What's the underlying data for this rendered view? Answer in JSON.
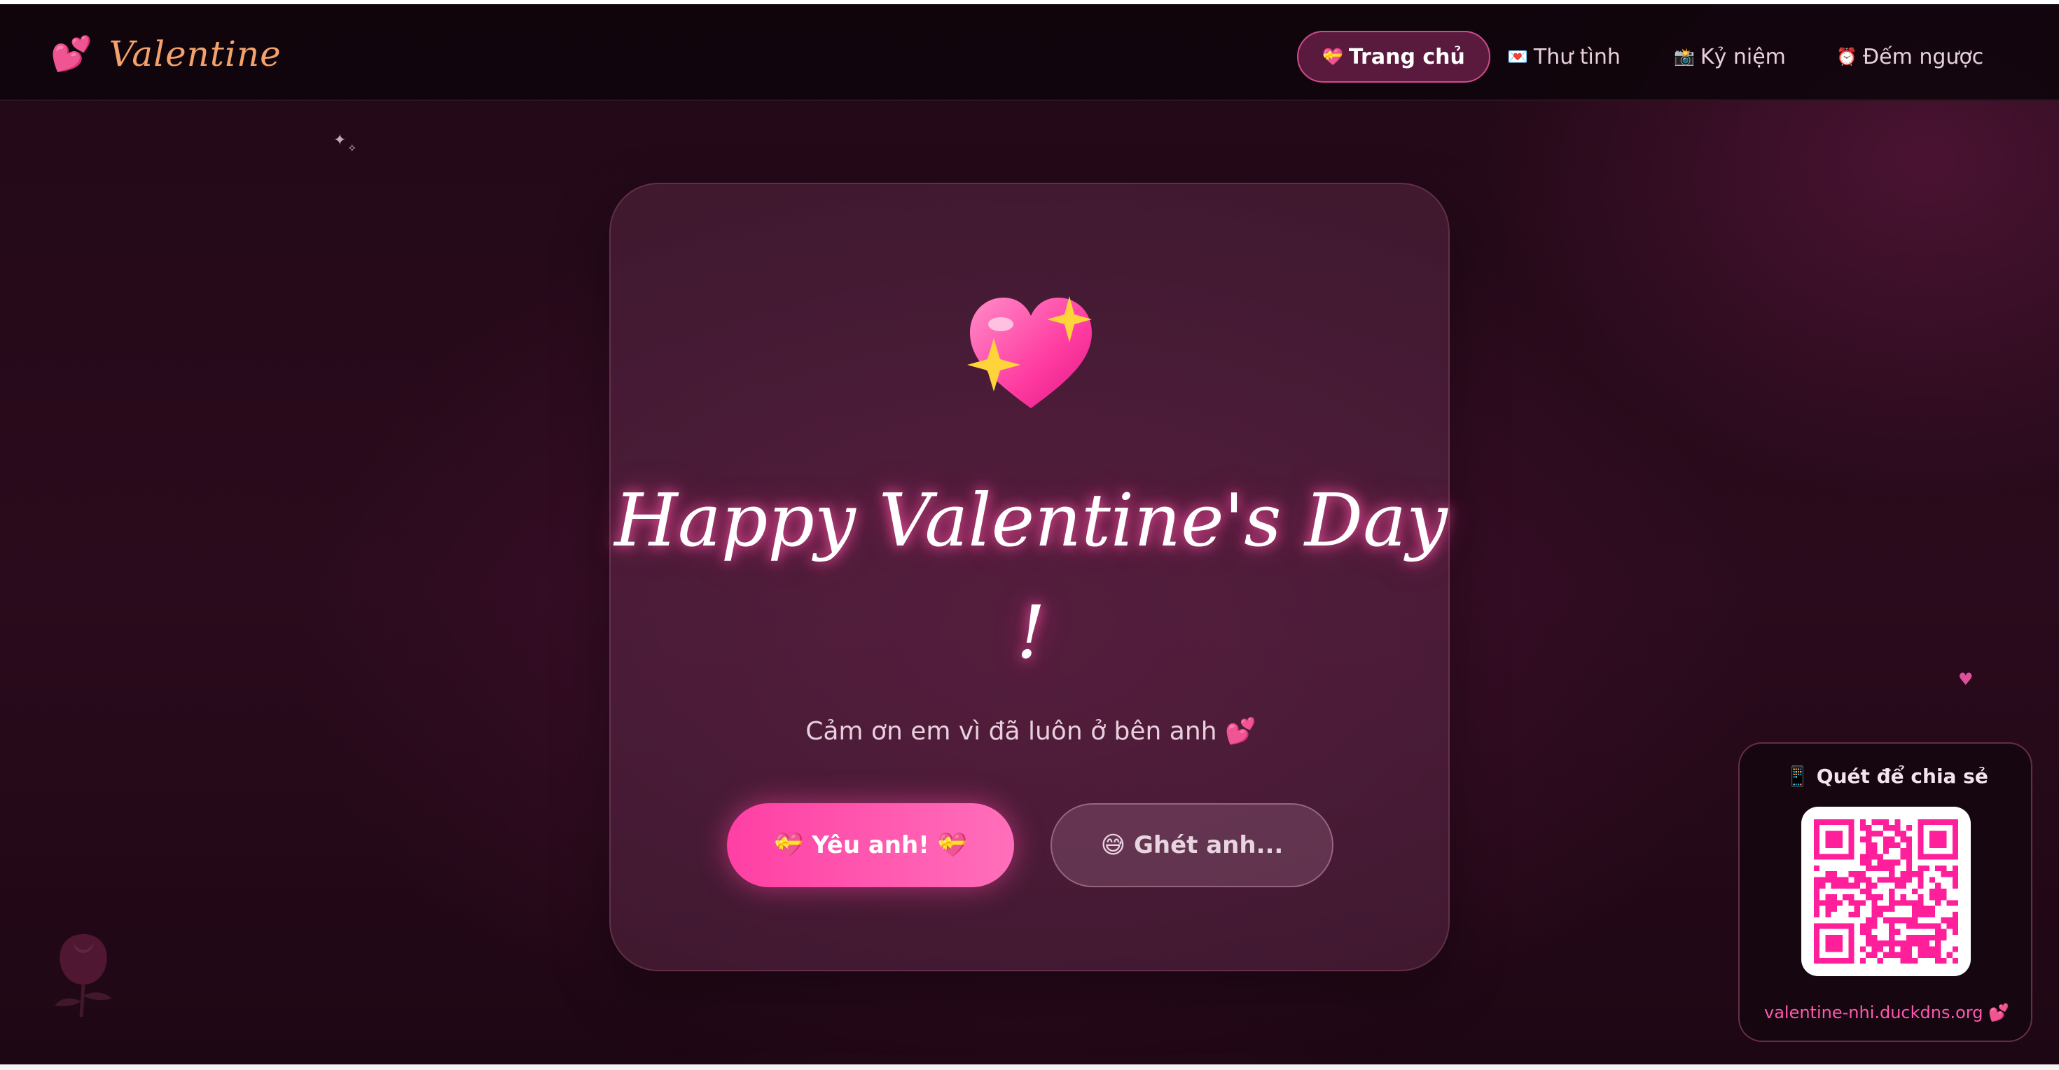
{
  "nav": {
    "logo_icon": "💕",
    "logo_text": "Valentine",
    "items": [
      {
        "icon": "💝",
        "label": "Trang chủ",
        "active": true
      },
      {
        "icon": "💌",
        "label": "Thư tình",
        "active": false
      },
      {
        "icon": "📸",
        "label": "Kỷ niệm",
        "active": false
      },
      {
        "icon": "⏰",
        "label": "Đếm ngược",
        "active": false
      }
    ]
  },
  "hero": {
    "icon": "sparkling-heart-icon",
    "title_line1": "Happy Valentine's Day",
    "title_line2": "!",
    "subtitle": "Cảm ơn em vì đã luôn ở bên anh 💕",
    "love_button": "💝 Yêu anh! 💝",
    "hate_button": "😅 Ghét anh..."
  },
  "share": {
    "title": "📱 Quét để chia sẻ",
    "url": "valentine-nhi.duckdns.org 💕"
  },
  "colors": {
    "accent": "#ff3fa4",
    "qr": "#ff1f9a",
    "logo": "#f2a26a"
  }
}
